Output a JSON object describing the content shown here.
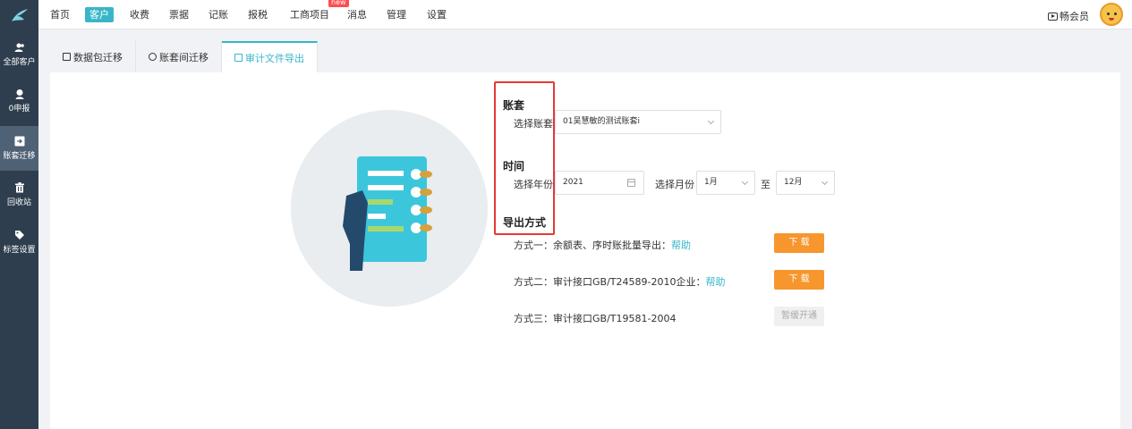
{
  "topnav": {
    "items": [
      "首页",
      "客户",
      "收费",
      "票据",
      "记账",
      "报税",
      "工商项目",
      "消息",
      "管理",
      "设置"
    ],
    "active_index": 1,
    "new_badge": "new",
    "member_label": "畅会员"
  },
  "sidebar": {
    "items": [
      {
        "label": "全部客户",
        "icon": "users-icon"
      },
      {
        "label": "0申报",
        "icon": "user-zero-icon"
      },
      {
        "label": "账套迁移",
        "icon": "migrate-icon"
      },
      {
        "label": "回收站",
        "icon": "trash-icon"
      },
      {
        "label": "标签设置",
        "icon": "tag-icon"
      }
    ],
    "active_index": 2
  },
  "tabs": [
    {
      "label": "数据包迁移",
      "icon": "package-icon"
    },
    {
      "label": "账套间迁移",
      "icon": "transfer-icon"
    },
    {
      "label": "审计文件导出",
      "icon": "export-icon"
    }
  ],
  "form": {
    "account_title": "账套",
    "account_label": "选择账套：",
    "account_value": "01吴慧敏的测试账套i",
    "time_title": "时间",
    "year_label": "选择年份：",
    "year_value": "2021",
    "month_label": "选择月份：",
    "month_from": "1月",
    "month_to_label": "至",
    "month_to": "12月",
    "export_title": "导出方式"
  },
  "methods": {
    "m1_text": "方式一：余额表、序时账批量导出：",
    "m1_help": "帮助",
    "m1_btn": "下 载",
    "m2_text": "方式二：审计接口GB/T24589-2010企业：",
    "m2_help": "帮助",
    "m2_btn": "下 载",
    "m3_text": "方式三：审计接口GB/T19581-2004",
    "m3_btn": "暂缓开通"
  },
  "colors": {
    "accent": "#38b6c8",
    "sidebar_bg": "#2e3e4e",
    "download_btn": "#f7962d",
    "highlight_border": "#e53935"
  }
}
